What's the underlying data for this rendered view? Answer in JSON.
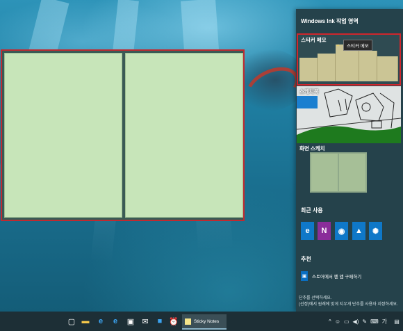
{
  "panel": {
    "title": "Windows Ink 작업 영역",
    "tiles": {
      "sticky_notes": "스티커 메모",
      "sticky_tooltip": "스티커 메모",
      "sketchpad": "스케치북",
      "screen_sketch": "화면 스케치"
    },
    "recent": {
      "title": "최근 사용",
      "apps": [
        {
          "icon": "edge-icon",
          "glyph": "e",
          "color": "#0f78c8"
        },
        {
          "icon": "onenote-icon",
          "glyph": "N",
          "color": "#8a2d9a"
        },
        {
          "icon": "maps-icon",
          "glyph": "◉",
          "color": "#0f78c8"
        },
        {
          "icon": "photos-icon",
          "glyph": "▲",
          "color": "#0f78c8"
        },
        {
          "icon": "tips-icon",
          "glyph": "✺",
          "color": "#0f78c8"
        }
      ]
    },
    "suggested": {
      "title": "추천",
      "store_text": "스토어에서 펜 앱 구매하기"
    },
    "pen_hint_line1": "단추를 선택하세요.",
    "pen_hint_line2": "(선정)에서 원래에 맞게 지우개 단추를 사용자 지정하세요."
  },
  "taskbar": {
    "sticky_label": "Sticky Notes",
    "icons": [
      "task-view-icon",
      "file-explorer-icon",
      "internet-explorer-icon",
      "edge-icon",
      "store-icon",
      "mail-icon",
      "app-icon",
      "alarm-icon"
    ],
    "tray": [
      "chevron-up-icon",
      "people-icon",
      "battery-icon",
      "volume-icon",
      "pen-icon",
      "keyboard-icon",
      "ime-icon",
      "notification-icon"
    ]
  },
  "colors": {
    "highlight": "#c12a30",
    "note_green": "#c7e5b9",
    "note_yellow": "#cbc595",
    "panel_bg": "#25424b"
  }
}
